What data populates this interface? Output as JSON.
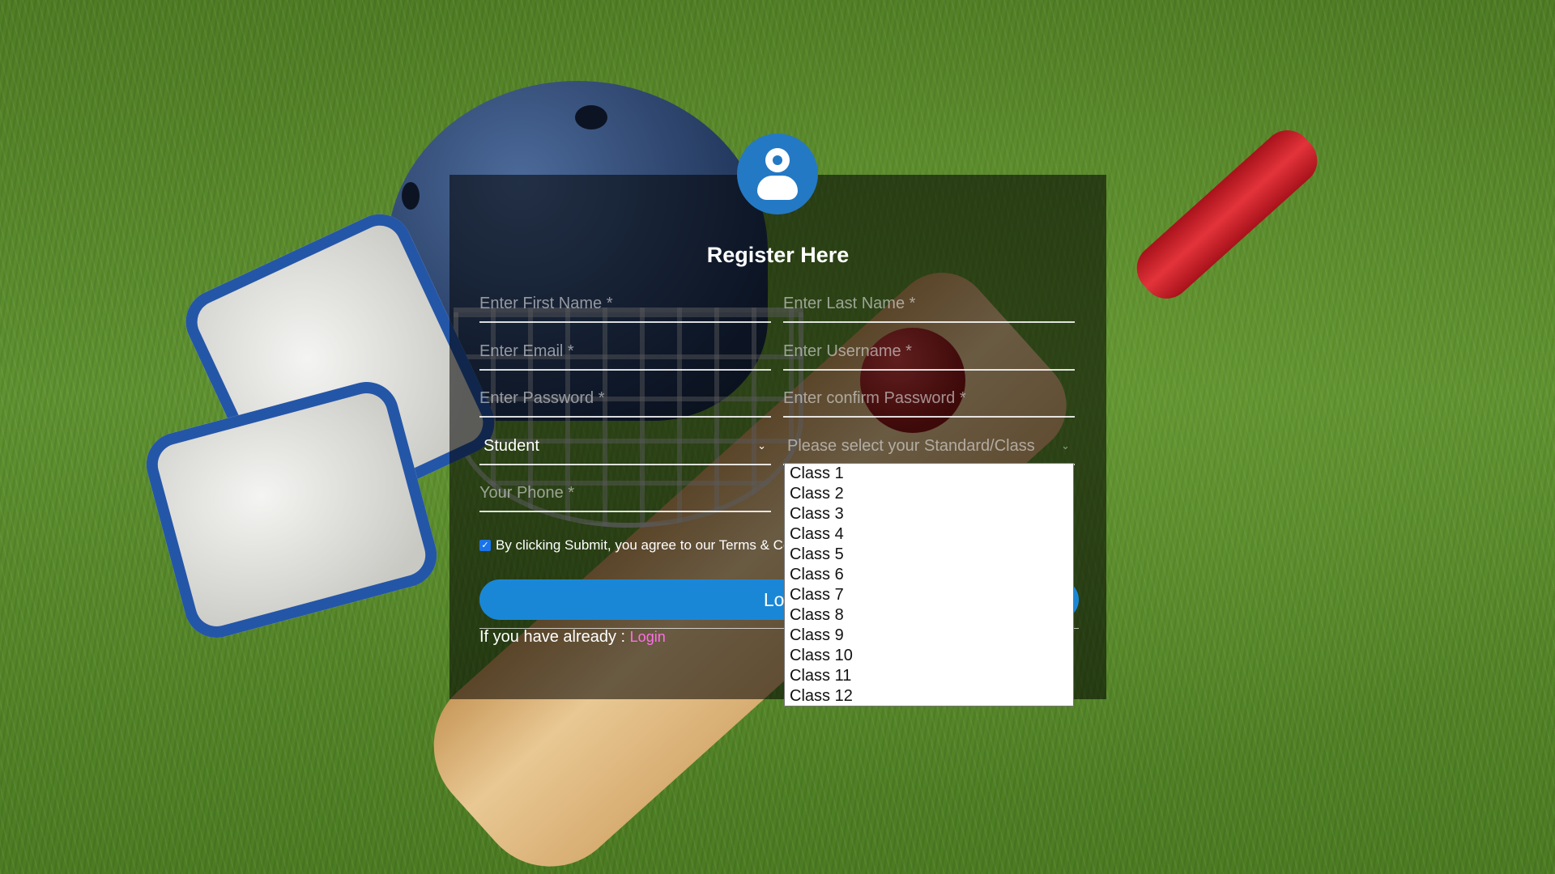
{
  "form": {
    "title": "Register Here",
    "fields": {
      "first_name": "Enter First Name *",
      "last_name": "Enter Last Name *",
      "email": "Enter Email *",
      "username": "Enter Username *",
      "password": "Enter Password *",
      "confirm_password": "Enter confirm Password *",
      "phone": "Your Phone *"
    },
    "role_select": {
      "value": "Student"
    },
    "class_select": {
      "placeholder": "Please select your Standard/Class",
      "options": [
        "Class 1",
        "Class 2",
        "Class 3",
        "Class 4",
        "Class 5",
        "Class 6",
        "Class 7",
        "Class 8",
        "Class 9",
        "Class 10",
        "Class 11",
        "Class 12"
      ]
    },
    "terms_text": "By clicking Submit, you agree to our Terms & Co",
    "terms_checked": true,
    "submit_label": "Log",
    "already_text": "If you have already : ",
    "login_link": "Login"
  },
  "colors": {
    "accent": "#1a87d6",
    "avatar": "#2479c4",
    "link": "#ff6fe8"
  },
  "icons": {
    "avatar": "user-icon",
    "select_chevron": "chevron-down-icon"
  }
}
